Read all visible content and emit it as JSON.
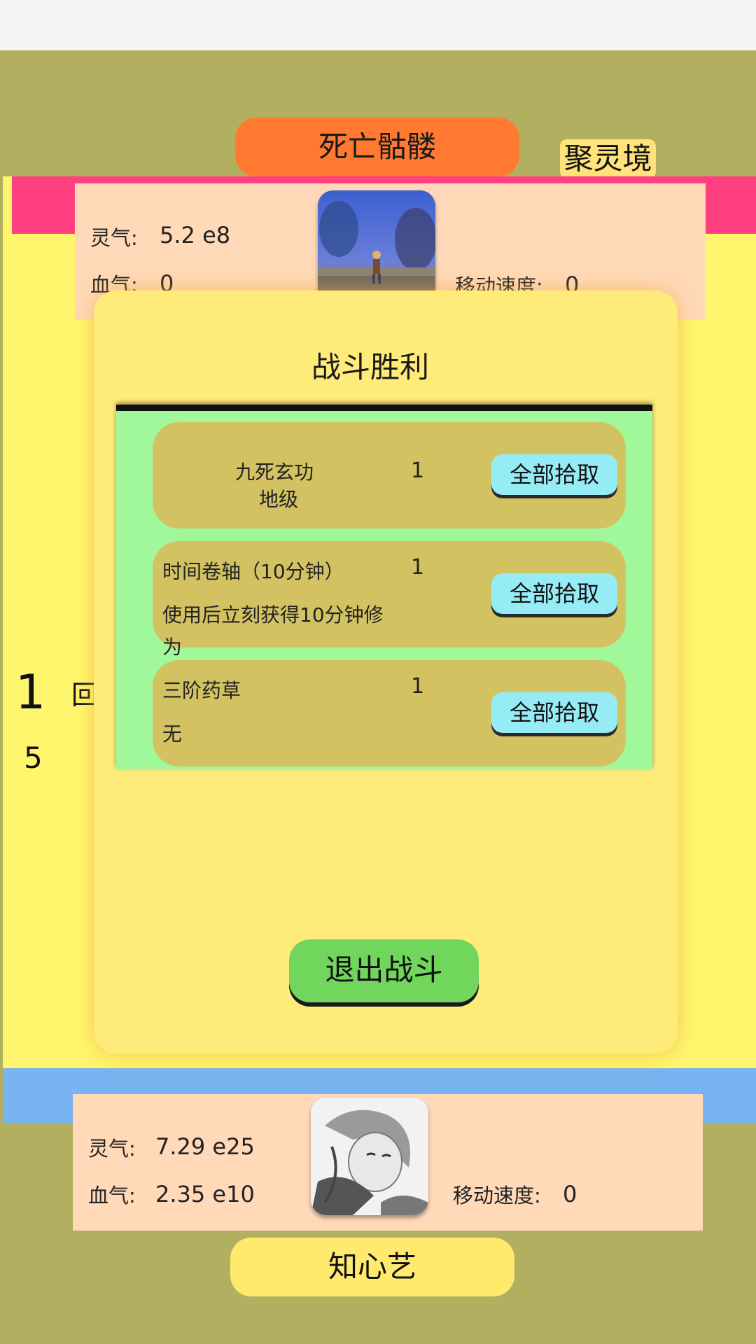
{
  "battle": {
    "enemy_name": "死亡骷髅",
    "realm": "聚灵境",
    "enemy": {
      "lingqi_label": "灵气:",
      "lingqi_value": "5.2 e8",
      "xueqi_label": "血气:",
      "xueqi_value": "0",
      "speed_label": "移动速度:",
      "speed_value": "0"
    },
    "player": {
      "lingqi_label": "灵气:",
      "lingqi_value": "7.29 e25",
      "xueqi_label": "血气:",
      "xueqi_value": "2.35 e10",
      "speed_label": "移动速度:",
      "speed_value": "0"
    },
    "player_name": "知心艺",
    "side_number_1": "1",
    "side_number_2": "5",
    "side_char": "回"
  },
  "dialog": {
    "title": "战斗胜利",
    "exit_label": "退出战斗",
    "pick_label": "全部拾取",
    "items": [
      {
        "name": "九死玄功",
        "desc": "地级",
        "qty": "1"
      },
      {
        "name": "时间卷轴（10分钟）",
        "desc": "使用后立刻获得10分钟修为",
        "qty": "1"
      },
      {
        "name": "三阶药草",
        "desc": "无",
        "qty": "1"
      }
    ]
  },
  "colors": {
    "background": "#b2b060",
    "enemy_banner": "#ff7a30",
    "pink_band": "#ff3f80",
    "arena": "#fff66e",
    "blue_band": "#78b4f2",
    "dialog": "#ffeb7a",
    "loot_bg": "#a0f89a",
    "loot_row": "#d3c262",
    "pick_button": "#96ecf4",
    "exit_button": "#70d65c"
  }
}
